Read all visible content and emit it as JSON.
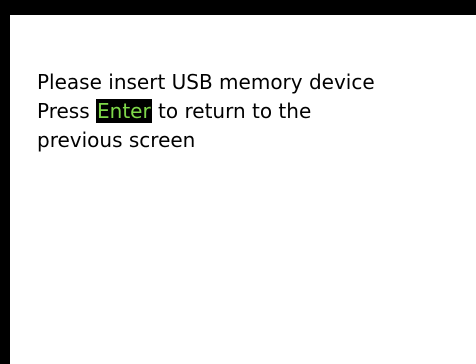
{
  "dialog": {
    "line1": "Please insert USB memory device",
    "line2_before": "Press ",
    "line2_key": "Enter",
    "line2_after": " to return to the",
    "line3": "previous screen"
  },
  "colors": {
    "background": "#ffffff",
    "frame": "#000000",
    "text": "#000000",
    "key_highlight_bg": "#000000",
    "key_highlight_text": "#7fd84a"
  }
}
